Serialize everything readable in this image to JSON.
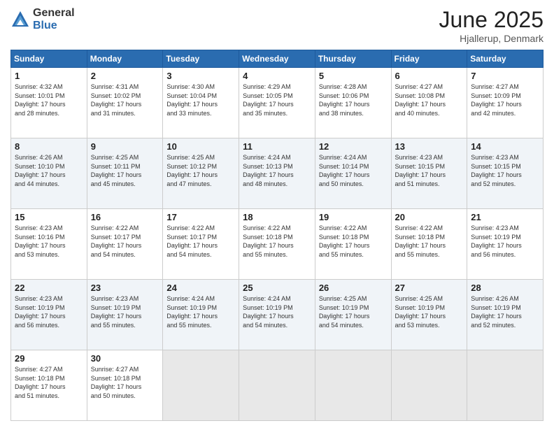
{
  "logo": {
    "general": "General",
    "blue": "Blue"
  },
  "title": "June 2025",
  "location": "Hjallerup, Denmark",
  "days_header": [
    "Sunday",
    "Monday",
    "Tuesday",
    "Wednesday",
    "Thursday",
    "Friday",
    "Saturday"
  ],
  "weeks": [
    [
      {
        "num": "1",
        "info": "Sunrise: 4:32 AM\nSunset: 10:01 PM\nDaylight: 17 hours\nand 28 minutes."
      },
      {
        "num": "2",
        "info": "Sunrise: 4:31 AM\nSunset: 10:02 PM\nDaylight: 17 hours\nand 31 minutes."
      },
      {
        "num": "3",
        "info": "Sunrise: 4:30 AM\nSunset: 10:04 PM\nDaylight: 17 hours\nand 33 minutes."
      },
      {
        "num": "4",
        "info": "Sunrise: 4:29 AM\nSunset: 10:05 PM\nDaylight: 17 hours\nand 35 minutes."
      },
      {
        "num": "5",
        "info": "Sunrise: 4:28 AM\nSunset: 10:06 PM\nDaylight: 17 hours\nand 38 minutes."
      },
      {
        "num": "6",
        "info": "Sunrise: 4:27 AM\nSunset: 10:08 PM\nDaylight: 17 hours\nand 40 minutes."
      },
      {
        "num": "7",
        "info": "Sunrise: 4:27 AM\nSunset: 10:09 PM\nDaylight: 17 hours\nand 42 minutes."
      }
    ],
    [
      {
        "num": "8",
        "info": "Sunrise: 4:26 AM\nSunset: 10:10 PM\nDaylight: 17 hours\nand 44 minutes."
      },
      {
        "num": "9",
        "info": "Sunrise: 4:25 AM\nSunset: 10:11 PM\nDaylight: 17 hours\nand 45 minutes."
      },
      {
        "num": "10",
        "info": "Sunrise: 4:25 AM\nSunset: 10:12 PM\nDaylight: 17 hours\nand 47 minutes."
      },
      {
        "num": "11",
        "info": "Sunrise: 4:24 AM\nSunset: 10:13 PM\nDaylight: 17 hours\nand 48 minutes."
      },
      {
        "num": "12",
        "info": "Sunrise: 4:24 AM\nSunset: 10:14 PM\nDaylight: 17 hours\nand 50 minutes."
      },
      {
        "num": "13",
        "info": "Sunrise: 4:23 AM\nSunset: 10:15 PM\nDaylight: 17 hours\nand 51 minutes."
      },
      {
        "num": "14",
        "info": "Sunrise: 4:23 AM\nSunset: 10:15 PM\nDaylight: 17 hours\nand 52 minutes."
      }
    ],
    [
      {
        "num": "15",
        "info": "Sunrise: 4:23 AM\nSunset: 10:16 PM\nDaylight: 17 hours\nand 53 minutes."
      },
      {
        "num": "16",
        "info": "Sunrise: 4:22 AM\nSunset: 10:17 PM\nDaylight: 17 hours\nand 54 minutes."
      },
      {
        "num": "17",
        "info": "Sunrise: 4:22 AM\nSunset: 10:17 PM\nDaylight: 17 hours\nand 54 minutes."
      },
      {
        "num": "18",
        "info": "Sunrise: 4:22 AM\nSunset: 10:18 PM\nDaylight: 17 hours\nand 55 minutes."
      },
      {
        "num": "19",
        "info": "Sunrise: 4:22 AM\nSunset: 10:18 PM\nDaylight: 17 hours\nand 55 minutes."
      },
      {
        "num": "20",
        "info": "Sunrise: 4:22 AM\nSunset: 10:18 PM\nDaylight: 17 hours\nand 55 minutes."
      },
      {
        "num": "21",
        "info": "Sunrise: 4:23 AM\nSunset: 10:19 PM\nDaylight: 17 hours\nand 56 minutes."
      }
    ],
    [
      {
        "num": "22",
        "info": "Sunrise: 4:23 AM\nSunset: 10:19 PM\nDaylight: 17 hours\nand 56 minutes."
      },
      {
        "num": "23",
        "info": "Sunrise: 4:23 AM\nSunset: 10:19 PM\nDaylight: 17 hours\nand 55 minutes."
      },
      {
        "num": "24",
        "info": "Sunrise: 4:24 AM\nSunset: 10:19 PM\nDaylight: 17 hours\nand 55 minutes."
      },
      {
        "num": "25",
        "info": "Sunrise: 4:24 AM\nSunset: 10:19 PM\nDaylight: 17 hours\nand 54 minutes."
      },
      {
        "num": "26",
        "info": "Sunrise: 4:25 AM\nSunset: 10:19 PM\nDaylight: 17 hours\nand 54 minutes."
      },
      {
        "num": "27",
        "info": "Sunrise: 4:25 AM\nSunset: 10:19 PM\nDaylight: 17 hours\nand 53 minutes."
      },
      {
        "num": "28",
        "info": "Sunrise: 4:26 AM\nSunset: 10:19 PM\nDaylight: 17 hours\nand 52 minutes."
      }
    ],
    [
      {
        "num": "29",
        "info": "Sunrise: 4:27 AM\nSunset: 10:18 PM\nDaylight: 17 hours\nand 51 minutes."
      },
      {
        "num": "30",
        "info": "Sunrise: 4:27 AM\nSunset: 10:18 PM\nDaylight: 17 hours\nand 50 minutes."
      },
      {
        "num": "",
        "info": ""
      },
      {
        "num": "",
        "info": ""
      },
      {
        "num": "",
        "info": ""
      },
      {
        "num": "",
        "info": ""
      },
      {
        "num": "",
        "info": ""
      }
    ]
  ]
}
